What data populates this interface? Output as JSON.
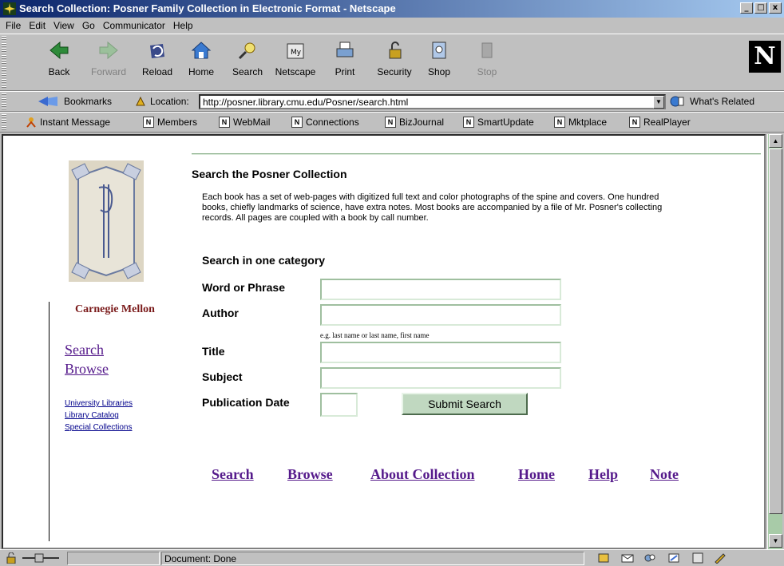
{
  "window": {
    "title": "Search Collection: Posner Family Collection in Electronic Format - Netscape",
    "controls": [
      "_",
      "□",
      "x"
    ]
  },
  "menu": [
    "File",
    "Edit",
    "View",
    "Go",
    "Communicator",
    "Help"
  ],
  "toolbar": {
    "buttons": [
      {
        "label": "Back",
        "icon": "back-arrow-icon",
        "enabled": true
      },
      {
        "label": "Forward",
        "icon": "forward-arrow-icon",
        "enabled": false
      },
      {
        "label": "Reload",
        "icon": "reload-icon",
        "enabled": true
      },
      {
        "label": "Home",
        "icon": "home-icon",
        "enabled": true
      },
      {
        "label": "Search",
        "icon": "search-icon",
        "enabled": true
      },
      {
        "label": "Netscape",
        "icon": "netscape-icon",
        "enabled": true
      },
      {
        "label": "Print",
        "icon": "print-icon",
        "enabled": true
      },
      {
        "label": "Security",
        "icon": "lock-icon",
        "enabled": true
      },
      {
        "label": "Shop",
        "icon": "shop-icon",
        "enabled": true
      },
      {
        "label": "Stop",
        "icon": "stop-icon",
        "enabled": false
      }
    ],
    "brand_letter": "N"
  },
  "location": {
    "bookmarks_label": "Bookmarks",
    "location_label": "Location:",
    "url": "http://posner.library.cmu.edu/Posner/search.html",
    "related_label": "What's Related"
  },
  "personal_toolbar": [
    "Instant Message",
    "Members",
    "WebMail",
    "Connections",
    "BizJournal",
    "SmartUpdate",
    "Mktplace",
    "RealPlayer"
  ],
  "sidebar": {
    "org": "Carnegie Mellon",
    "links": [
      "Search",
      "Browse"
    ],
    "small_links": [
      "University Libraries",
      "Library Catalog",
      "Special Collections"
    ]
  },
  "main": {
    "heading": "Search the Posner Collection",
    "description": "Each book has a set of web-pages with digitized full text and color photographs of the spine and covers. One hundred books, chiefly landmarks of science, have extra notes. Most books are accompanied by a file of Mr. Posner's collecting records. All pages are coupled with a book by call number.",
    "subheading": "Search in one category",
    "fields": [
      {
        "label": "Word or Phrase",
        "value": ""
      },
      {
        "label": "Author",
        "value": ""
      },
      {
        "label": "Title",
        "value": ""
      },
      {
        "label": "Subject",
        "value": ""
      },
      {
        "label": "Publication Date",
        "value": ""
      }
    ],
    "author_hint": "e.g. last name or last name, first name",
    "submit_label": "Submit Search"
  },
  "footer_links": [
    "Search",
    "Browse",
    "About Collection",
    "Home",
    "Help",
    "Note"
  ],
  "status": {
    "text": "Document: Done"
  },
  "colors": {
    "visited_link": "#551a8b",
    "brand_maroon": "#7a1a1a",
    "scroll_green": "#a8cba8"
  }
}
